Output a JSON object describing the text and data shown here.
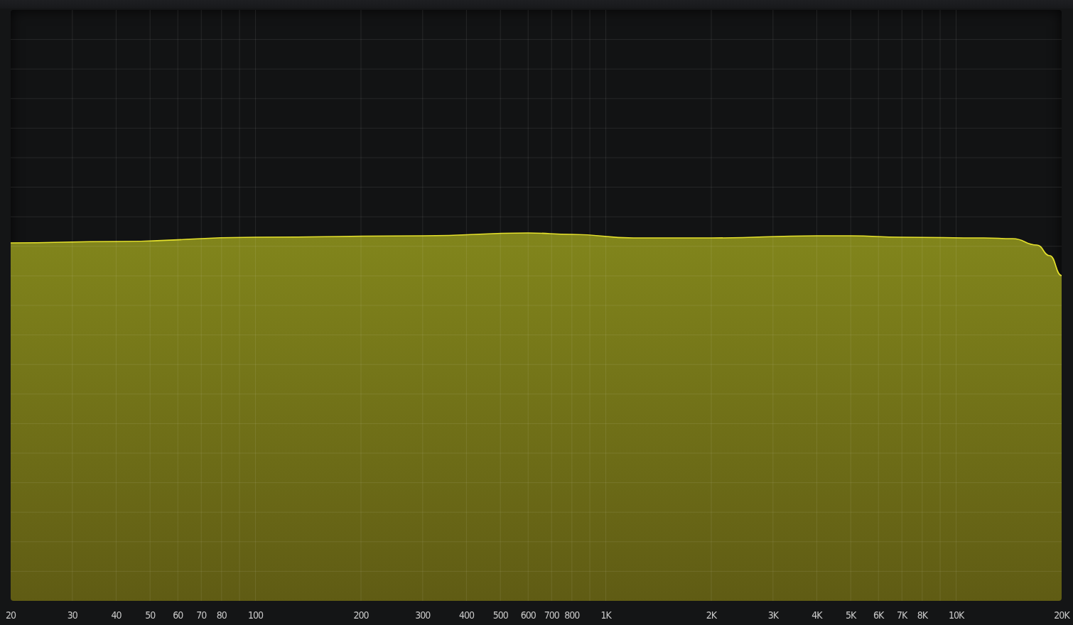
{
  "analyzer": {
    "frequency_labels": [
      "20",
      "30",
      "40",
      "50",
      "60",
      "70",
      "80",
      "100",
      "200",
      "300",
      "400",
      "500",
      "600",
      "700",
      "800",
      "1K",
      "2K",
      "3K",
      "4K",
      "5K",
      "6K",
      "7K",
      "8K",
      "10K",
      "20K"
    ]
  }
}
